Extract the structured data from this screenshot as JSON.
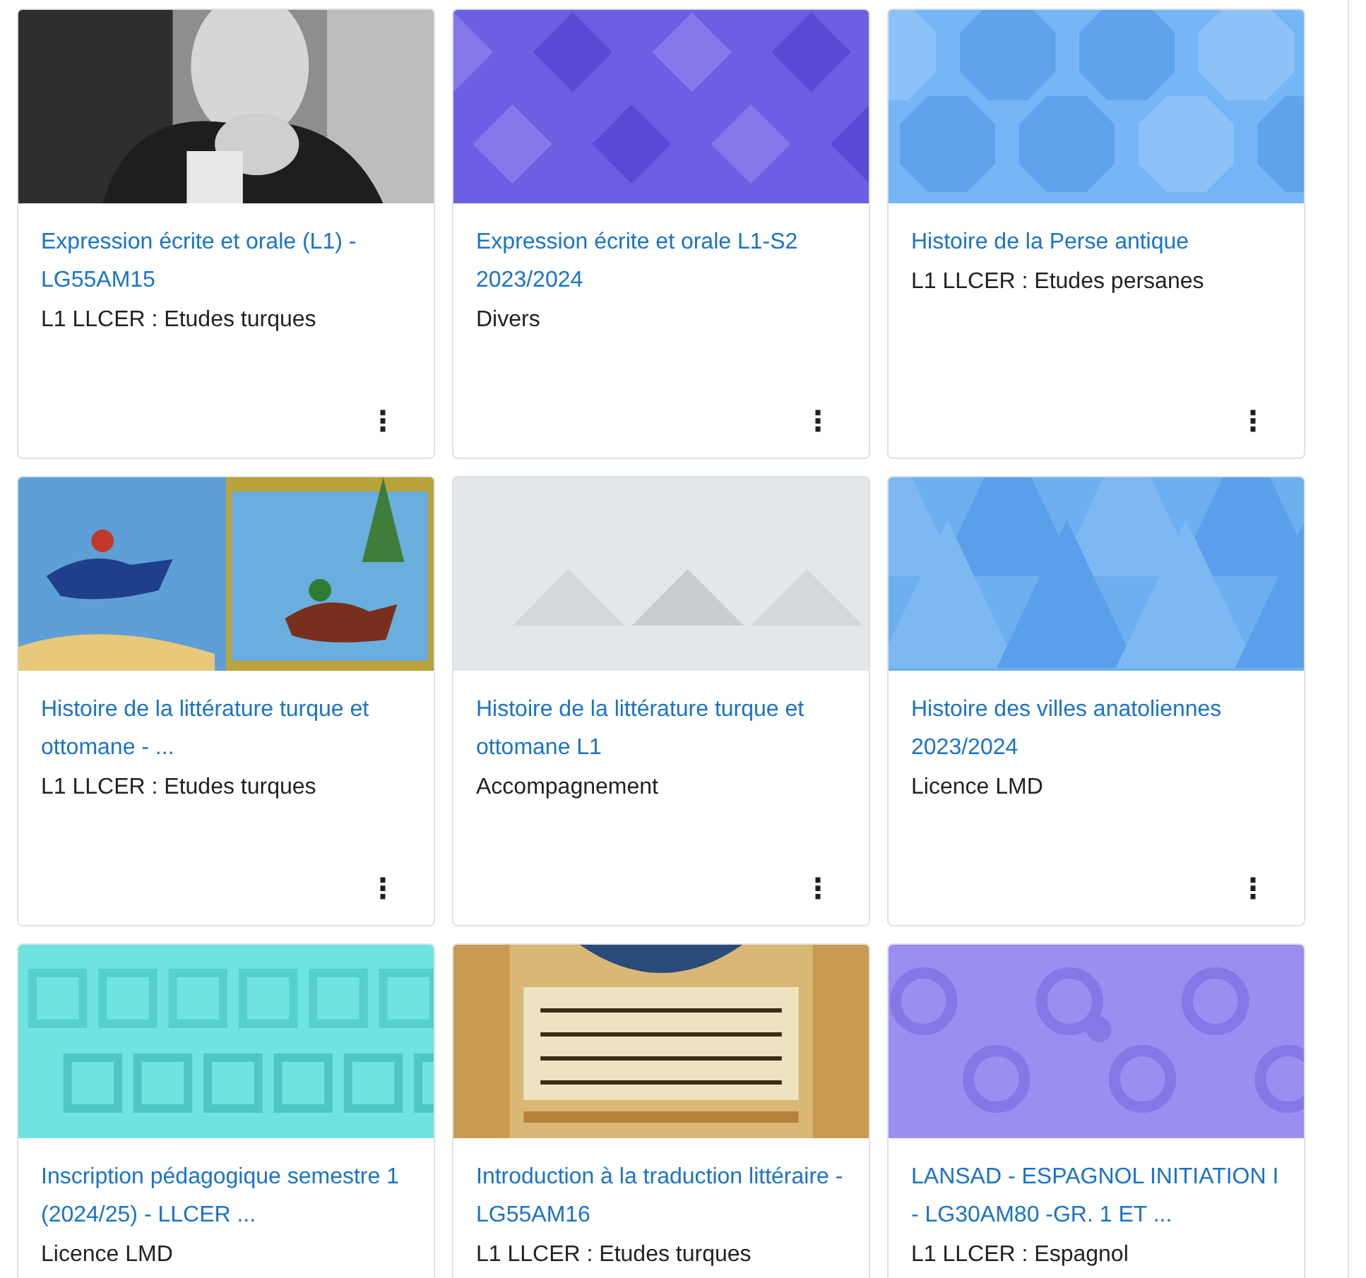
{
  "courses": [
    {
      "title": "Expression écrite et orale (L1) - LG55AM15",
      "category": "L1 LLCER : Etudes turques",
      "menu": "⋮"
    },
    {
      "title": "Expression écrite et orale L1-S2 2023/2024",
      "category": "Divers",
      "menu": "⋮"
    },
    {
      "title": "Histoire de la Perse antique",
      "category": "L1 LLCER : Etudes persanes",
      "menu": "⋮"
    },
    {
      "title": "Histoire de la littérature turque et ottomane - ...",
      "category": "L1 LLCER : Etudes turques",
      "menu": "⋮"
    },
    {
      "title": "Histoire de la littérature turque et ottomane L1",
      "category": "Accompagnement",
      "menu": "⋮"
    },
    {
      "title": "Histoire des villes anatoliennes 2023/2024",
      "category": "Licence LMD",
      "menu": "⋮"
    },
    {
      "title": "Inscription pédagogique semestre 1 (2024/25) - LLCER ...",
      "category": "Licence LMD"
    },
    {
      "title": "Introduction à la traduction littéraire - LG55AM16",
      "category": "L1 LLCER : Etudes turques"
    },
    {
      "title": "LANSAD - ESPAGNOL INITIATION I - LG30AM80 -GR. 1 ET ...",
      "category": "L1 LLCER : Espagnol"
    }
  ]
}
